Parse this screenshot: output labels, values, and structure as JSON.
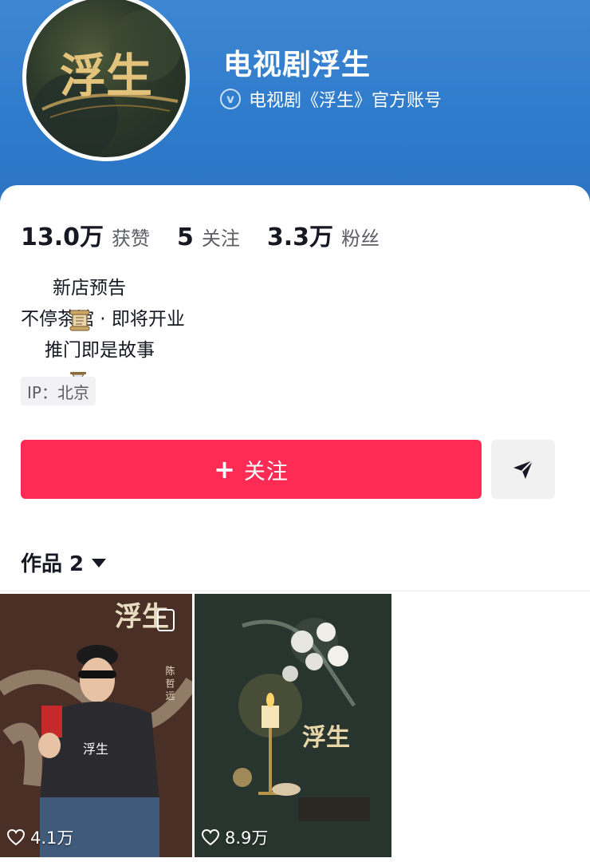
{
  "profile": {
    "name": "电视剧浮生",
    "verification": "电视剧《浮生》官方账号",
    "avatar_text": "浮生"
  },
  "stats": [
    {
      "value": "13.0万",
      "label": "获赞"
    },
    {
      "value": "5",
      "label": "关注"
    },
    {
      "value": "3.3万",
      "label": "粉丝"
    }
  ],
  "bio": {
    "line1": "新店预告",
    "line2": "不停茶馆 · 即将开业",
    "line3": "推门即是故事",
    "line1_icon": "scroll-icon",
    "line3_icon": "hourglass-icon"
  },
  "ip": "IP：北京",
  "actions": {
    "follow_plus": "+",
    "follow_label": "关注",
    "share_icon": "send-icon"
  },
  "works": {
    "tab_label": "作品 2",
    "items": [
      {
        "likes": "4.1万",
        "overlay_title": "浮生",
        "side_name": "陈 哲 远"
      },
      {
        "likes": "8.9万",
        "overlay_title": "浮生"
      }
    ]
  },
  "colors": {
    "header_blue": "#2f7ccc",
    "follow_red": "#fe2c55"
  }
}
